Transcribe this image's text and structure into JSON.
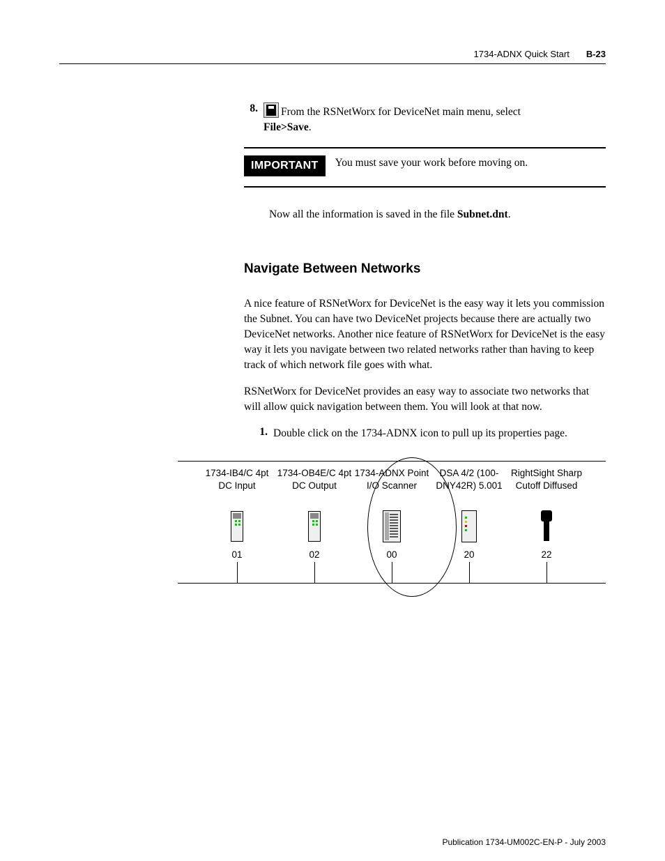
{
  "header": {
    "title": "1734-ADNX Quick Start",
    "page": "B-23"
  },
  "step8": {
    "num": "8.",
    "text_before": "From the RSNetWorx for DeviceNet main menu, select",
    "bold": "File>Save",
    "after": "."
  },
  "important": {
    "label": "IMPORTANT",
    "text": "You must save your work before moving on."
  },
  "saved_para": {
    "before": "Now all the information is saved in the file ",
    "bold": "Subnet.dnt",
    "after": "."
  },
  "heading": "Navigate Between Networks",
  "p1": "A nice feature of RSNetWorx for DeviceNet is the easy way it lets you commission the Subnet. You can have two DeviceNet projects because there are actually two DeviceNet networks. Another nice feature of RSNetWorx for DeviceNet is the easy way it lets you navigate between two related networks rather than having to keep track of which network file goes with what.",
  "p2": "RSNetWorx for DeviceNet provides an easy way to associate two networks that will allow quick navigation between them. You will look at that now.",
  "step1": {
    "num": "1.",
    "text": "Double click on the 1734-ADNX icon to pull up its properties page."
  },
  "devices": [
    {
      "label": "1734-IB4/C 4pt DC Input",
      "addr": "01",
      "type": "mod"
    },
    {
      "label": "1734-OB4E/C 4pt DC Output",
      "addr": "02",
      "type": "mod"
    },
    {
      "label": "1734-ADNX Point I/O Scanner",
      "addr": "00",
      "type": "scanner"
    },
    {
      "label": "DSA 4/2 (100-DNY42R) 5.001",
      "addr": "20",
      "type": "dsa"
    },
    {
      "label": "RightSight Sharp Cutoff Diffused",
      "addr": "22",
      "type": "sensor"
    }
  ],
  "footer": "Publication 1734-UM002C-EN-P - July 2003"
}
